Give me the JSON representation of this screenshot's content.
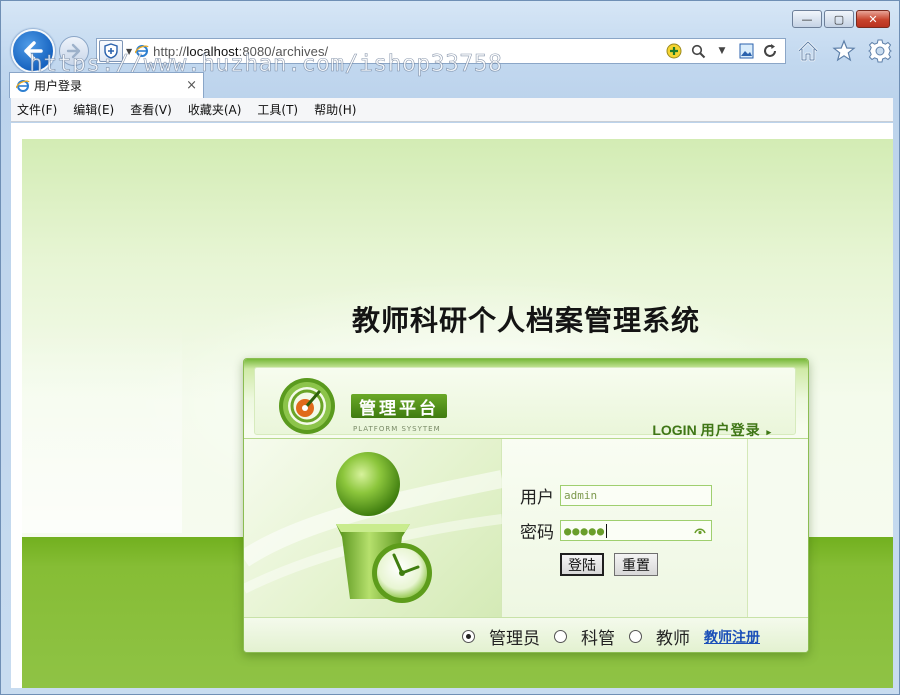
{
  "browser": {
    "address": {
      "prefix": "http://",
      "host": "localhost",
      "rest": ":8080/archives/"
    },
    "tab": {
      "title": "用户登录",
      "close": "×"
    },
    "menu": [
      {
        "label": "文件(F)"
      },
      {
        "label": "编辑(E)"
      },
      {
        "label": "查看(V)"
      },
      {
        "label": "收藏夹(A)"
      },
      {
        "label": "工具(T)"
      },
      {
        "label": "帮助(H)"
      }
    ],
    "window_buttons": {
      "minimize": "—",
      "maximize": "▢",
      "close": "✕"
    },
    "watermark": "https://www.huzhan.com/ishop33758"
  },
  "page": {
    "title": "教师科研个人档案管理系统",
    "panel": {
      "brand": "管理平台",
      "brand_sub": "PLATFORM SYSYTEM",
      "login_en": "LOGIN",
      "login_cn": "用户登录",
      "login_arrow": "▸"
    },
    "form": {
      "user_label": "用户",
      "user_value": "admin",
      "password_label": "密码",
      "password_mask": "●●●●●",
      "login_button": "登陆",
      "reset_button": "重置"
    },
    "roles": [
      {
        "label": "管理员",
        "selected": true
      },
      {
        "label": "科管",
        "selected": false
      },
      {
        "label": "教师",
        "selected": false
      }
    ],
    "register_link": "教师注册"
  },
  "colors": {
    "accent_green": "#72b01f",
    "link_blue": "#1a4fb8",
    "ie_blue": "#1663c0"
  }
}
